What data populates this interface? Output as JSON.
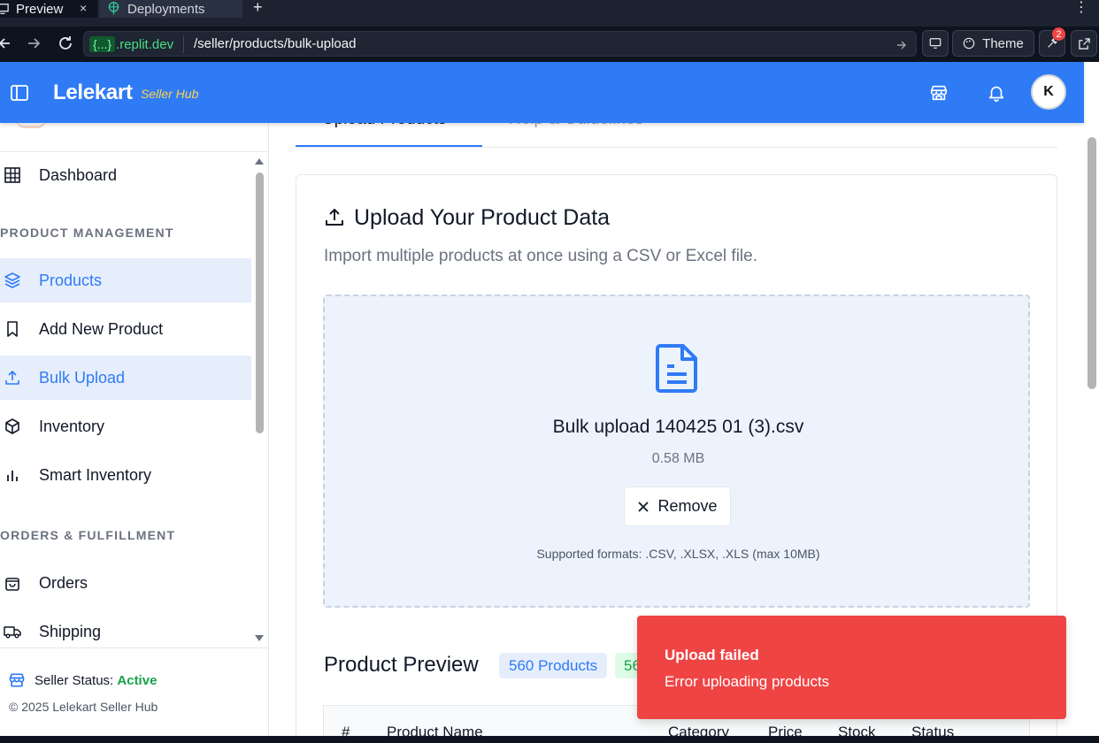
{
  "browser": {
    "tabs": [
      {
        "label": "Preview",
        "close": "×"
      },
      {
        "label": "Deployments"
      }
    ],
    "new_tab": "+",
    "menu": "⋮",
    "url_host_braces": "{...}",
    "url_host": ".replit.dev",
    "url_path": "/seller/products/bulk-upload",
    "theme_label": "Theme",
    "notification_count": "2"
  },
  "header": {
    "brand": "Lelekart",
    "brand_sub": "Seller Hub",
    "avatar_initial": "K"
  },
  "sidebar": {
    "items": [
      {
        "label": "Dashboard"
      },
      {
        "label": "Products"
      },
      {
        "label": "Add New Product"
      },
      {
        "label": "Bulk Upload"
      },
      {
        "label": "Inventory"
      },
      {
        "label": "Smart Inventory"
      },
      {
        "label": "Orders"
      },
      {
        "label": "Shipping"
      }
    ],
    "sections": {
      "product_management": "PRODUCT MANAGEMENT",
      "orders_fulfillment": "ORDERS & FULFILLMENT"
    },
    "footer": {
      "status_label": "Seller Status:",
      "status_value": "Active",
      "copyright": "© 2025 Lelekart Seller Hub"
    }
  },
  "main": {
    "tabs": [
      "Upload Products",
      "Help & Guidelines"
    ],
    "card_title": "Upload Your Product Data",
    "card_desc": "Import multiple products at once using a CSV or Excel file.",
    "file": {
      "name": "Bulk upload 140425 01 (3).csv",
      "size": "0.58 MB",
      "remove_label": "Remove",
      "formats": "Supported formats: .CSV, .XLSX, .XLS (max 10MB)"
    },
    "preview": {
      "title": "Product Preview",
      "count_badge": "560 Products",
      "valid_badge": "56",
      "columns": [
        "#",
        "Product Name",
        "Category",
        "Price",
        "Stock",
        "Status"
      ]
    }
  },
  "toast": {
    "title": "Upload failed",
    "message": "Error uploading products"
  },
  "colors": {
    "primary": "#2f7bf6",
    "toast_error": "#ef4444",
    "active_green": "#16a34a",
    "brand_sub": "#fcd34d"
  }
}
